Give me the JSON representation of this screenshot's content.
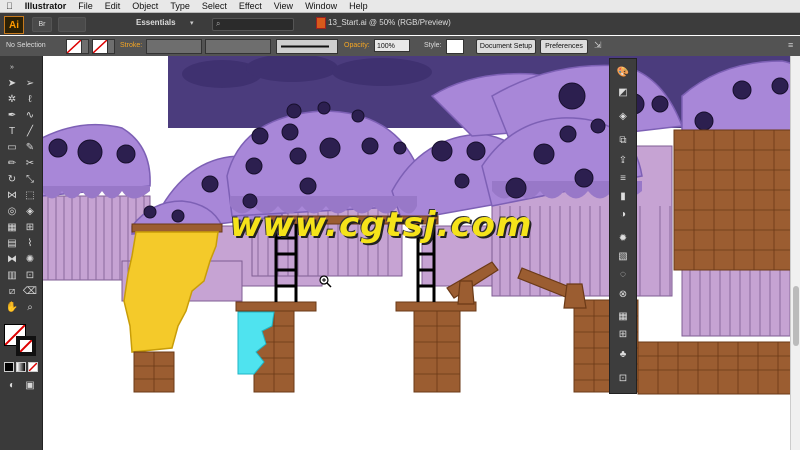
{
  "menubar": {
    "apple": "",
    "app_name": "Illustrator",
    "items": [
      "File",
      "Edit",
      "Object",
      "Type",
      "Select",
      "Effect",
      "View",
      "Window",
      "Help"
    ]
  },
  "appbar": {
    "logo": "Ai",
    "br_icon": "Br",
    "workspace": "Essentials",
    "document_title": "13_Start.ai @ 50% (RGB/Preview)"
  },
  "control": {
    "selection_status": "No Selection",
    "stroke_label": "Stroke:",
    "opacity_label": "Opacity:",
    "opacity_value": "100%",
    "style_label": "Style:",
    "document_setup": "Document Setup",
    "preferences": "Preferences"
  },
  "watermark": "www.cgtsj.com",
  "colors": {
    "sky": "#4b3c7d",
    "cap": "#a887d8",
    "cap_dark": "#8c6bc3",
    "berry": "#2c1f4f",
    "liner": "#c9a6d6",
    "brick": "#9b5d31",
    "brick_line": "#6b3a17",
    "cheese": "#f4ca2a",
    "water": "#4fe3ef",
    "accent": "#ff9a00"
  }
}
